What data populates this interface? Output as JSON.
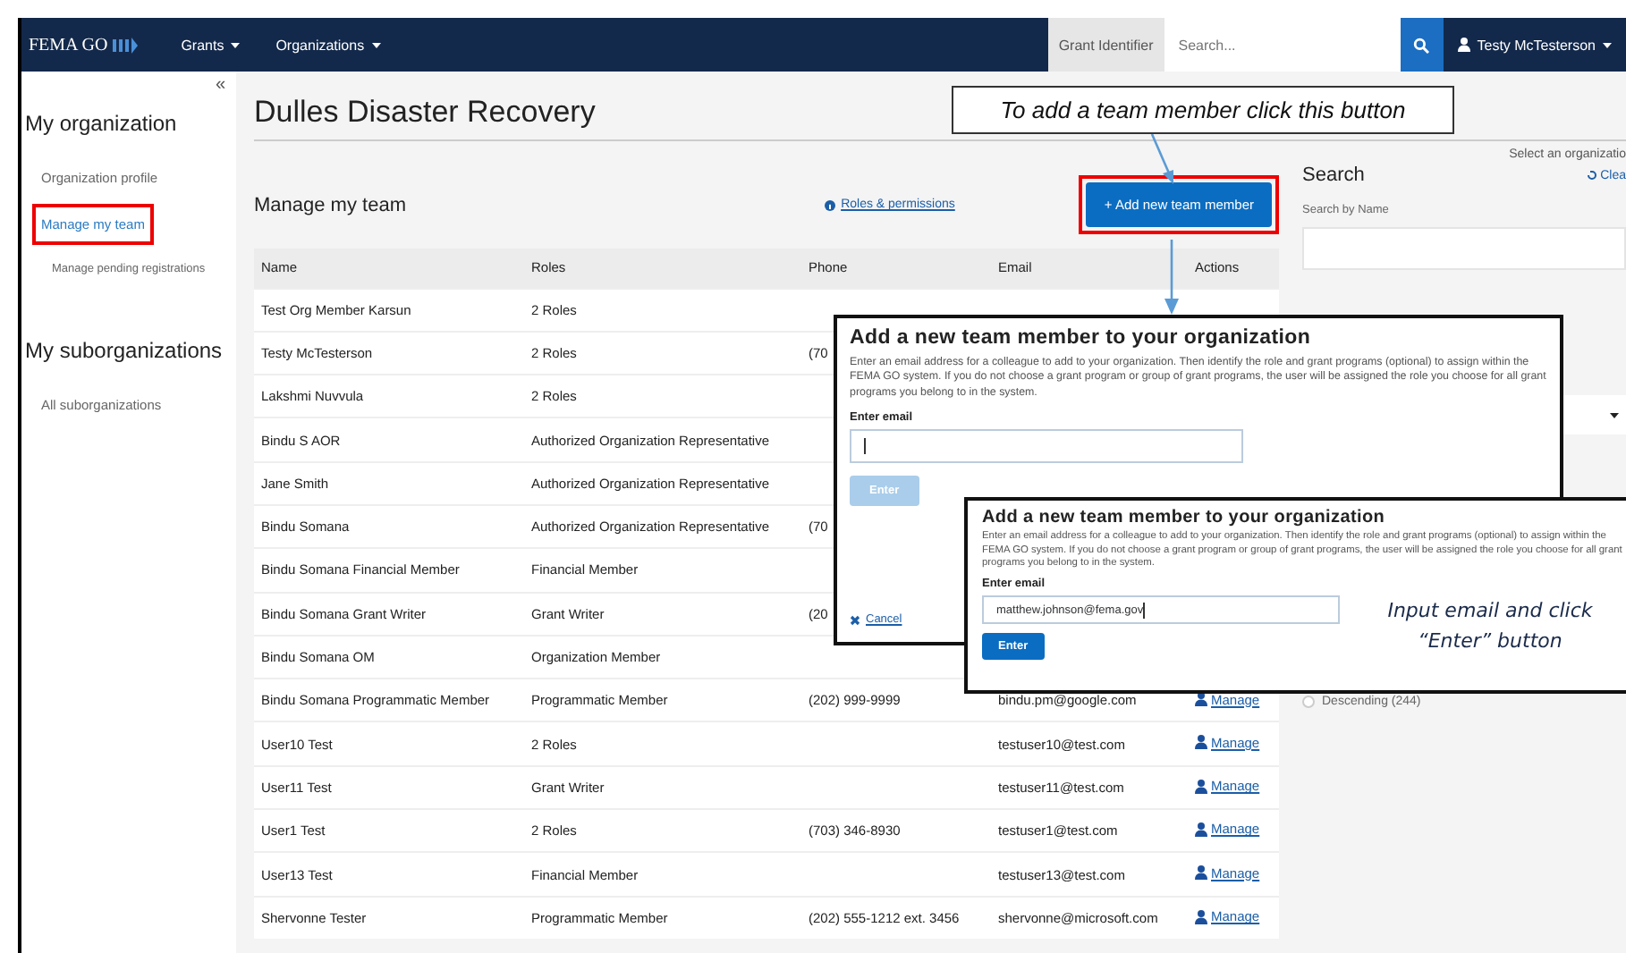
{
  "nav": {
    "logo": "FEMA GO",
    "menus": [
      {
        "label": "Grants"
      },
      {
        "label": "Organizations"
      }
    ],
    "grant_identifier": "Grant Identifier",
    "search": {
      "placeholder": "Search..."
    },
    "user": "Testy McTesterson"
  },
  "sidebar": {
    "collapse": "«",
    "sections": [
      {
        "title": "My organization",
        "items": [
          {
            "label": "Organization profile",
            "selected": false,
            "highlighted": false
          },
          {
            "label": "Manage my team",
            "selected": true,
            "highlighted": true,
            "children": [
              {
                "label": "Manage pending registrations",
                "selected": false,
                "highlighted": false
              }
            ]
          }
        ]
      },
      {
        "title": "My suborganizations",
        "items": [
          {
            "label": "All suborganizations",
            "selected": false,
            "highlighted": false
          }
        ]
      }
    ]
  },
  "page": {
    "title": "Dulles Disaster Recovery",
    "org_select_hint": "Select an organizatio"
  },
  "team": {
    "heading": "Manage my team",
    "roles_link": "Roles & permissions",
    "add_button": {
      "label": "+ Add new team member",
      "highlighted": true
    },
    "columns": [
      "Name",
      "Roles",
      "Phone",
      "Email",
      "Actions"
    ],
    "rows": [
      {
        "name": "Test Org Member Karsun",
        "roles": "2 Roles"
      },
      {
        "name": "Testy McTesterson",
        "roles": "2 Roles",
        "phone": "(70"
      },
      {
        "name": "Lakshmi Nuvvula",
        "roles": "2 Roles"
      },
      {
        "name": "Bindu S AOR",
        "roles": "Authorized Organization Representative"
      },
      {
        "name": "Jane Smith",
        "roles": "Authorized Organization Representative"
      },
      {
        "name": "Bindu Somana",
        "roles": "Authorized Organization Representative",
        "phone": "(70"
      },
      {
        "name": "Bindu Somana Financial Member",
        "roles": "Financial Member"
      },
      {
        "name": "Bindu Somana Grant Writer",
        "roles": "Grant Writer",
        "phone": "(20"
      },
      {
        "name": "Bindu Somana OM",
        "roles": "Organization Member"
      },
      {
        "name": "Bindu Somana Programmatic Member",
        "roles": "Programmatic Member",
        "phone": "(202) 999-9999",
        "email": "bindu.pm@google.com",
        "action": "Manage"
      },
      {
        "name": "User10 Test",
        "roles": "2 Roles",
        "email": "testuser10@test.com",
        "action": "Manage"
      },
      {
        "name": "User11 Test",
        "roles": "Grant Writer",
        "email": "testuser11@test.com",
        "action": "Manage"
      },
      {
        "name": "User1 Test",
        "roles": "2 Roles",
        "phone": "(703) 346-8930",
        "email": "testuser1@test.com",
        "action": "Manage"
      },
      {
        "name": "User13 Test",
        "roles": "Financial Member",
        "email": "testuser13@test.com",
        "action": "Manage"
      },
      {
        "name": "Shervonne Tester",
        "roles": "Programmatic Member",
        "phone": "(202) 555-1212 ext. 3456",
        "email": "shervonne@microsoft.com",
        "action": "Manage"
      }
    ]
  },
  "search_panel": {
    "title": "Search",
    "clear": "Clea",
    "search_by_name_label": "Search by Name",
    "sort_option": {
      "label": "Descending (244)",
      "selected": false
    }
  },
  "dialogs": [
    {
      "title": "Add a new team member to your organization",
      "text": "Enter an email address for a colleague to add to your organization. Then identify the role and grant programs (optional) to assign within the FEMA GO system. If you do not choose a grant program or group of grant programs, the user will be assigned the role you choose for all grant programs you belong to in the system.",
      "email_label": "Enter email",
      "enter_button": "Enter",
      "enter_disabled": true,
      "cancel": "Cancel"
    },
    {
      "title": "Add a new team member to your organization",
      "text": "Enter an email address for a colleague to add to your organization. Then identify the role and grant programs (optional) to assign within the FEMA GO system. If you do not choose a grant program or group of grant programs, the user will be assigned the role you choose for all grant programs you belong to in the system.",
      "email_label": "Enter email",
      "email_value": "matthew.johnson@fema.gov",
      "enter_button": "Enter",
      "enter_disabled": false
    }
  ],
  "annotations": [
    {
      "kind": "callout",
      "text": "To add a team member click this button"
    },
    {
      "kind": "note",
      "text": "Input email and click “Enter” button"
    }
  ]
}
